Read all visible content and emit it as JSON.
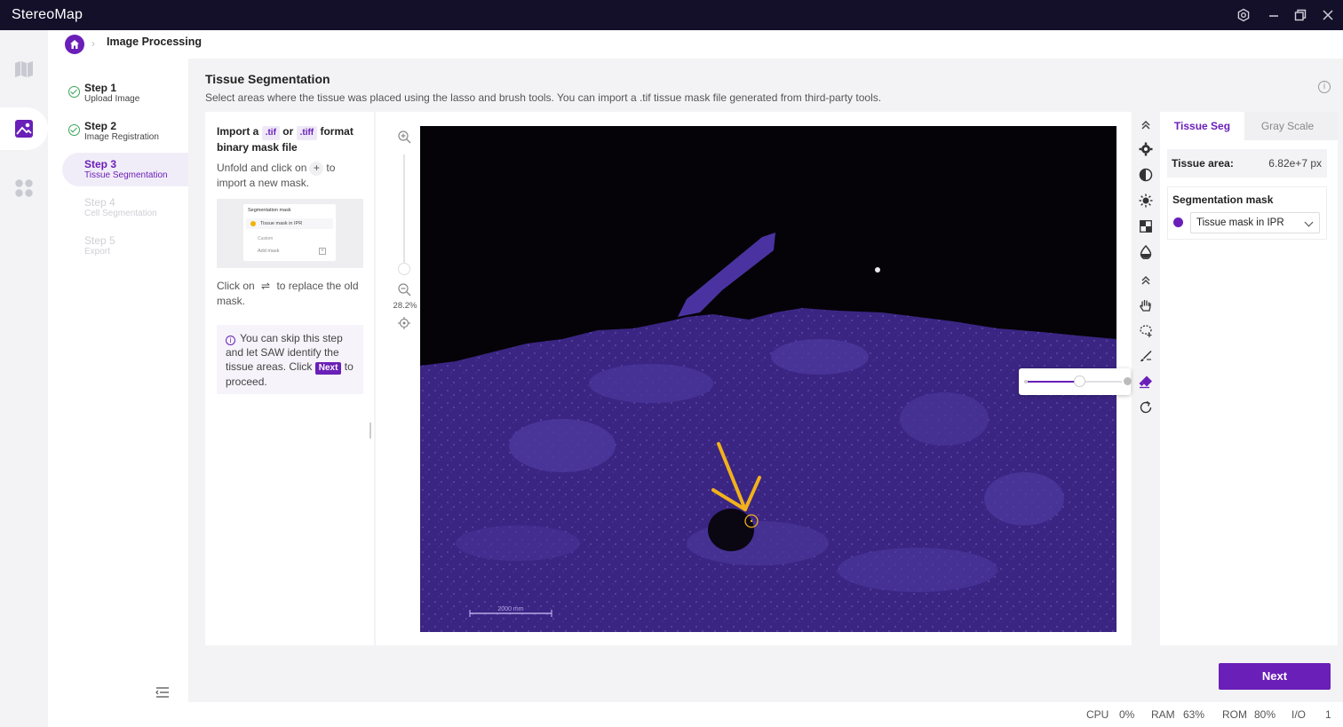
{
  "app": {
    "title": "StereoMap"
  },
  "breadcrumb": {
    "title": "Image Processing"
  },
  "steps": [
    {
      "title": "Step 1",
      "subtitle": "Upload Image",
      "state": "done"
    },
    {
      "title": "Step 2",
      "subtitle": "Image Registration",
      "state": "done"
    },
    {
      "title": "Step 3",
      "subtitle": "Tissue Segmentation",
      "state": "active"
    },
    {
      "title": "Step 4",
      "subtitle": "Cell Segmentation",
      "state": "disabled"
    },
    {
      "title": "Step 5",
      "subtitle": "Export",
      "state": "disabled"
    }
  ],
  "main": {
    "title": "Tissue Segmentation",
    "description": "Select areas where the tissue was placed using the lasso and brush tools. You can import a .tif tissue mask file generated from third-party tools."
  },
  "instructions": {
    "import_prefix": "Import a",
    "tif_chip": ".tif",
    "or_word": "or",
    "tiff_chip": ".tiff",
    "import_suffix": "format binary mask file",
    "unfold_text_a": "Unfold and click on",
    "plus_glyph": "+",
    "unfold_text_b": "to import a new mask.",
    "thumb_title": "Segmentation mask",
    "thumb_item": "Tissue mask in IPR",
    "thumb_custom": "Custom",
    "thumb_add": "Add mask",
    "replace_text_a": "Click on",
    "swap_glyph": "⇌",
    "replace_text_b": "to replace the old mask.",
    "skip_text_a": "You can skip this step and let SAW identify the tissue areas. Click",
    "skip_next_chip": "Next",
    "skip_text_b": "to proceed."
  },
  "viewer": {
    "zoom_percent": "28.2%",
    "scale_bar_label": "2000 mm"
  },
  "brush": {
    "size_level": 0.55
  },
  "right_panel": {
    "tabs": [
      "Tissue Seg",
      "Gray Scale"
    ],
    "active_tab": 0,
    "tissue_area_label": "Tissue area:",
    "tissue_area_value": "6.82e+7 px",
    "seg_mask_label": "Segmentation mask",
    "seg_mask_selected": "Tissue mask in IPR"
  },
  "colors": {
    "accent": "#6a1fb8",
    "titlebar": "#14102a",
    "annotation_arrow": "#f2b11a"
  },
  "next_button": {
    "label": "Next"
  },
  "status": {
    "cpu_label": "CPU",
    "cpu_value": "0%",
    "ram_label": "RAM",
    "ram_value": "63%",
    "rom_label": "ROM",
    "rom_value": "80%",
    "io_label": "I/O",
    "io_value": "1"
  }
}
